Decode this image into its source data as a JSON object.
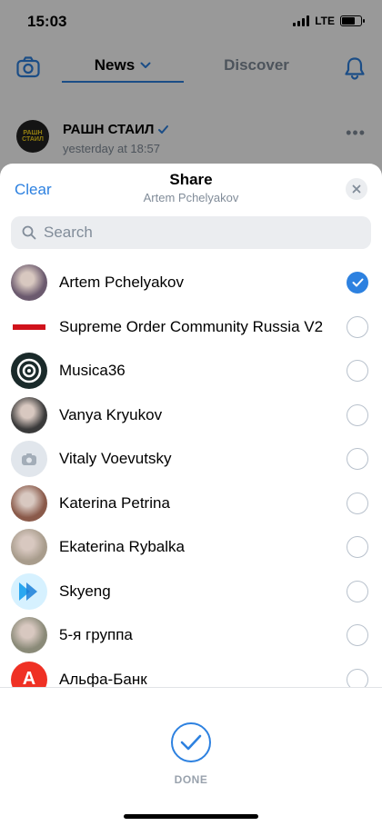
{
  "status_bar": {
    "time": "15:03",
    "network": "LTE"
  },
  "nav": {
    "tab_news": "News",
    "tab_discover": "Discover"
  },
  "post": {
    "title": "РАШН СТАИЛ",
    "subtitle": "yesterday at 18:57",
    "avatar_text": "РАШН СТАИЛ"
  },
  "sheet": {
    "clear_label": "Clear",
    "title": "Share",
    "subtitle": "Artem Pchelyakov",
    "search_placeholder": "Search",
    "done_label": "DONE",
    "contacts": [
      {
        "name": "Artem Pchelyakov",
        "checked": true,
        "avatar": "photo",
        "color": "#6b5a6e"
      },
      {
        "name": "Supreme Order Community Russia V2",
        "checked": false,
        "avatar": "supreme",
        "color": "#d0121b"
      },
      {
        "name": "Musica36",
        "checked": false,
        "avatar": "musica",
        "color": "#1a2a2a"
      },
      {
        "name": "Vanya Kryukov",
        "checked": false,
        "avatar": "photo",
        "color": "#3a3a3a"
      },
      {
        "name": "Vitaly Voevutsky",
        "checked": false,
        "avatar": "camera",
        "color": "#e1e6ec"
      },
      {
        "name": "Katerina Petrina",
        "checked": false,
        "avatar": "photo",
        "color": "#8a5a4a"
      },
      {
        "name": "Ekaterina Rybalka",
        "checked": false,
        "avatar": "photo",
        "color": "#a89c8c"
      },
      {
        "name": "Skyeng",
        "checked": false,
        "avatar": "skyeng",
        "color": "#2aa7f0"
      },
      {
        "name": "5-я группа",
        "checked": false,
        "avatar": "photo",
        "color": "#8a8a78"
      },
      {
        "name": "Альфа-Банк",
        "checked": false,
        "avatar": "alfa",
        "color": "#ef3124",
        "avatar_letter": "A"
      }
    ]
  },
  "colors": {
    "accent": "#2d81e0",
    "secondary_text": "#818c99"
  }
}
